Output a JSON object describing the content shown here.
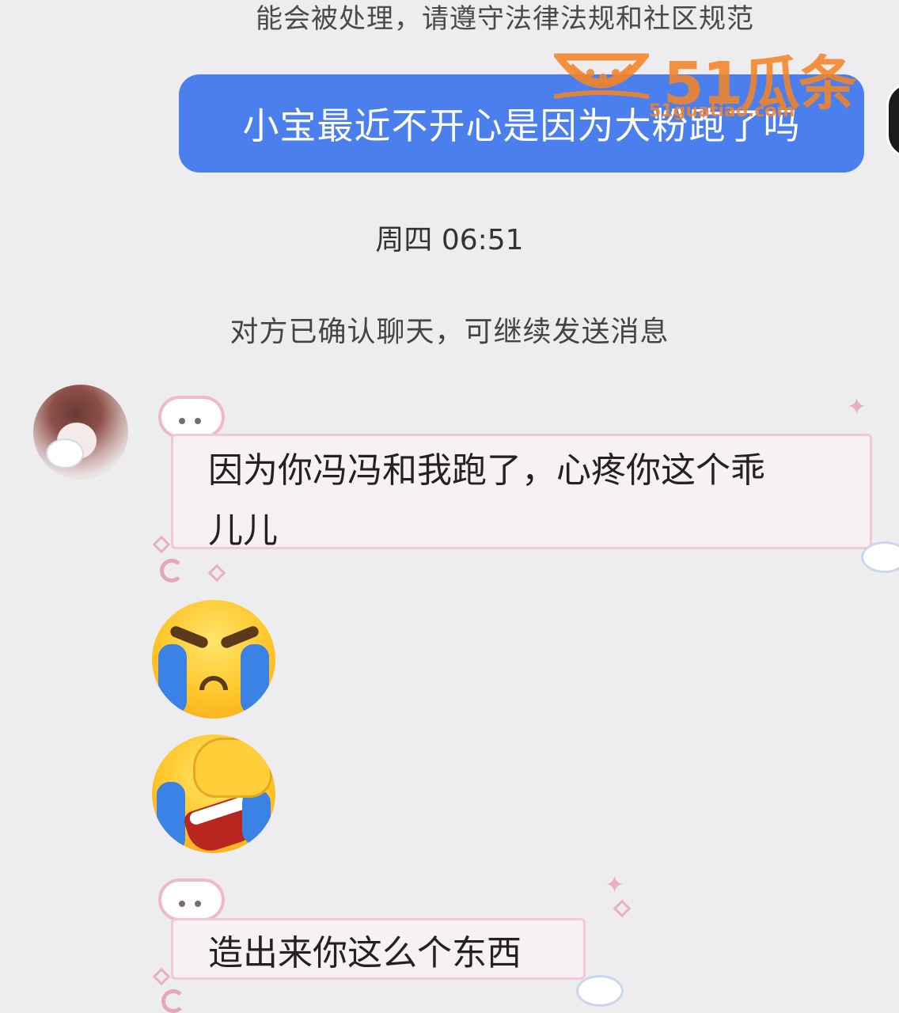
{
  "chat": {
    "top_notice": "能会被处理，请遵守法律法规和社区规范",
    "sent_message": "小宝最近不开心是因为大粉跑了吗",
    "timestamp": "周四 06:51",
    "system_notice": "对方已确认聊天，可继续发送消息",
    "received_messages": [
      {
        "text_line1": "因为你冯冯和我跑了，心疼你这个乖",
        "text_line2": "儿儿"
      },
      {
        "emoji": "loudly-crying-face"
      },
      {
        "emoji": "crying-facepalm-face"
      },
      {
        "text_line1": "造出来你这么个东西"
      }
    ]
  },
  "watermark": {
    "title": "51瓜条",
    "url": "51guatiao.com",
    "color": "#f48428"
  },
  "colors": {
    "background": "#ededf0",
    "sent_bubble": "#4b7fee",
    "received_bubble_border": "#f0c8d6"
  }
}
